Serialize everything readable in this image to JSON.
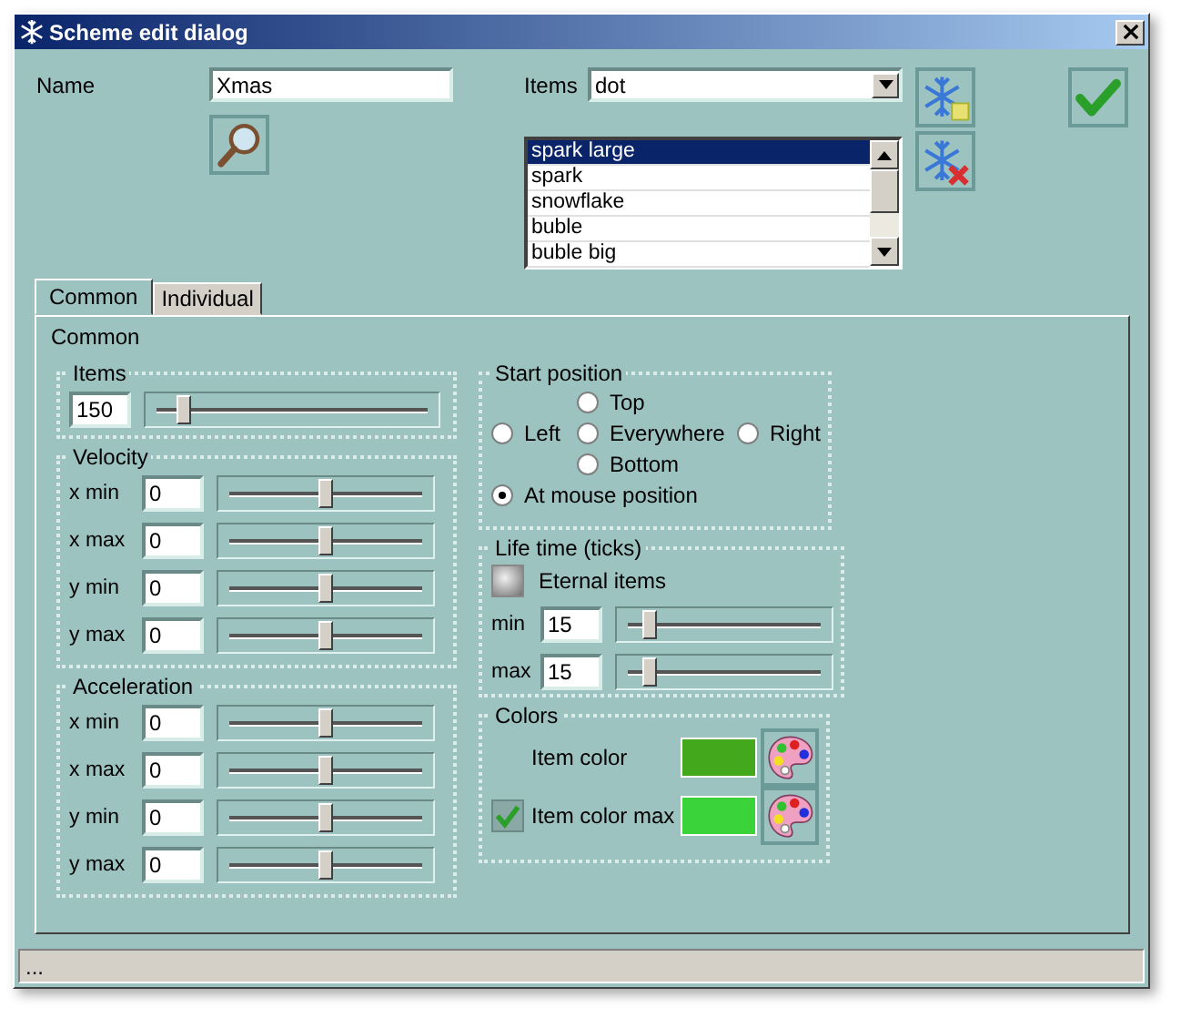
{
  "window": {
    "title": "Scheme edit dialog"
  },
  "name_field": {
    "label": "Name",
    "value": "Xmas"
  },
  "items_combo": {
    "label": "Items",
    "value": "dot"
  },
  "items_list": [
    {
      "label": "spark large",
      "selected": true
    },
    {
      "label": "spark",
      "selected": false
    },
    {
      "label": "snowflake",
      "selected": false
    },
    {
      "label": "buble",
      "selected": false
    },
    {
      "label": "buble big",
      "selected": false
    }
  ],
  "tabs": [
    {
      "label": "Common",
      "selected": true
    },
    {
      "label": "Individual",
      "selected": false
    }
  ],
  "panel_title": "Common",
  "items_group": {
    "title": "Items",
    "value": "150",
    "level": 0.13
  },
  "velocity": {
    "title": "Velocity",
    "rows": [
      {
        "label": "x min",
        "value": "0",
        "level": 0.5
      },
      {
        "label": "x max",
        "value": "0",
        "level": 0.5
      },
      {
        "label": "y min",
        "value": "0",
        "level": 0.5
      },
      {
        "label": "y max",
        "value": "0",
        "level": 0.5
      }
    ]
  },
  "acceleration": {
    "title": "Acceleration",
    "rows": [
      {
        "label": "x min",
        "value": "0",
        "level": 0.5
      },
      {
        "label": "x max",
        "value": "0",
        "level": 0.5
      },
      {
        "label": "y min",
        "value": "0",
        "level": 0.5
      },
      {
        "label": "y max",
        "value": "0",
        "level": 0.5
      }
    ]
  },
  "start_position": {
    "title": "Start position",
    "options": [
      {
        "label": "Top",
        "selected": false
      },
      {
        "label": "Left",
        "selected": false
      },
      {
        "label": "Everywhere",
        "selected": false
      },
      {
        "label": "Right",
        "selected": false
      },
      {
        "label": "Bottom",
        "selected": false
      },
      {
        "label": "At mouse position",
        "selected": true
      }
    ]
  },
  "life_time": {
    "title": "Life time (ticks)",
    "eternal": {
      "label": "Eternal items",
      "checked": false
    },
    "rows": [
      {
        "label": "min",
        "value": "15",
        "level": 0.15
      },
      {
        "label": "max",
        "value": "15",
        "level": 0.15
      }
    ]
  },
  "colors": {
    "title": "Colors",
    "rows": [
      {
        "kind": "plain",
        "label": "Item color",
        "color": "#44a81c"
      },
      {
        "kind": "checkbox",
        "label": "Item color max",
        "checked": true,
        "color": "#3ad43a"
      }
    ]
  },
  "status_bar": "..."
}
